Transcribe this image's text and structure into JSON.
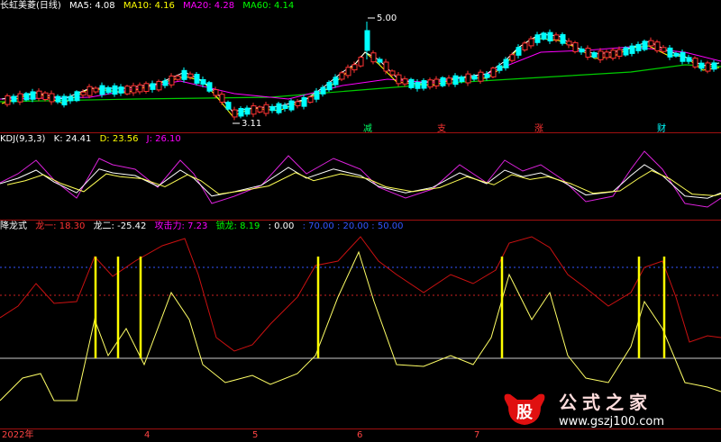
{
  "header_price": {
    "stock": "长虹美菱(日线)",
    "ma5": "MA5: 4.08",
    "ma10": "MA10: 4.16",
    "ma20": "MA20: 4.28",
    "ma60": "MA60: 4.14"
  },
  "header_kdj": {
    "name": "KDJ(9,3,3)",
    "k": "K: 24.41",
    "d": "D: 23.56",
    "j": "J: 26.10"
  },
  "header_ind": {
    "name": "降龙式",
    "l1": "龙一: 18.30",
    "l2": "龙二: -25.42",
    "atk": "攻击力: 7.23",
    "lock": "锁龙: 8.19",
    "zero": ": 0.00",
    "ref": ": 70.00 : 20.00 : 50.00"
  },
  "annotations": {
    "high": "5.00",
    "low": "3.11",
    "m1": "减",
    "m2": "支",
    "m3": "涨",
    "m4": "财"
  },
  "x_axis": {
    "year": "2022年",
    "months": [
      "4",
      "5",
      "6",
      "7"
    ]
  },
  "watermark": {
    "badge": "股",
    "title": "公式之家",
    "url": "www.gszj100.com"
  },
  "colors": {
    "up": "#ff3333",
    "down": "#00ffff",
    "ma5": "#ffffff",
    "ma10": "#ffff00",
    "ma20": "#ff00ff",
    "ma60": "#00cc00",
    "long1": "#cc1111",
    "long2": "#ffff66",
    "signal": "#ffff00"
  },
  "chart_data": [
    {
      "type": "candlestick",
      "title": "长虹美菱(日线)",
      "series": [
        {
          "name": "MA5",
          "value": 4.08
        },
        {
          "name": "MA10",
          "value": 4.16
        },
        {
          "name": "MA20",
          "value": 4.28
        },
        {
          "name": "MA60",
          "value": 4.14
        }
      ],
      "annotations": [
        {
          "label": "5.00",
          "type": "high"
        },
        {
          "label": "3.11",
          "type": "low"
        }
      ],
      "ylim": [
        3.0,
        5.2
      ]
    },
    {
      "type": "line",
      "title": "KDJ(9,3,3)",
      "series": [
        {
          "name": "K",
          "last": 24.41
        },
        {
          "name": "D",
          "last": 23.56
        },
        {
          "name": "J",
          "last": 26.1
        }
      ]
    },
    {
      "type": "line",
      "title": "降龙式",
      "series": [
        {
          "name": "龙一",
          "last": 18.3
        },
        {
          "name": "龙二",
          "last": -25.42
        },
        {
          "name": "攻击力",
          "last": 7.23
        },
        {
          "name": "锁龙",
          "last": 8.19
        }
      ],
      "reference_lines": [
        0,
        70,
        20,
        50
      ]
    }
  ]
}
